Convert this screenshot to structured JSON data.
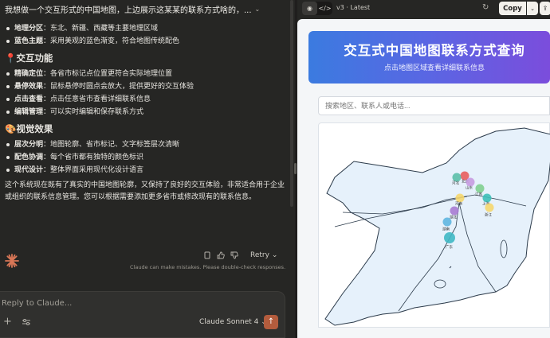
{
  "chat": {
    "title": "我想做一个交互形式的中国地图，上边展示这某某的联系方式啥的，...",
    "design_items": [
      {
        "label": "地理分区",
        "text": "：东北、新疆、西藏等主要地理区域"
      },
      {
        "label": "蓝色主题",
        "text": "：采用美观的蓝色渐变，符合地图传统配色"
      }
    ],
    "section_interaction": {
      "emoji": "📍",
      "title": "交互功能"
    },
    "interaction_items": [
      {
        "label": "精确定位",
        "text": "：各省市标记点位置更符合实际地理位置"
      },
      {
        "label": "悬停效果",
        "text": "：鼠标悬停时圆点会放大，提供更好的交互体验"
      },
      {
        "label": "点击查看",
        "text": "：点击任意省市查看详细联系信息"
      },
      {
        "label": "编辑管理",
        "text": "：可以实时编辑和保存联系方式"
      }
    ],
    "section_visual": {
      "emoji": "🎨",
      "title": "视觉效果"
    },
    "visual_items": [
      {
        "label": "层次分明",
        "text": "：地图轮廓、省市标记、文字标签层次清晰"
      },
      {
        "label": "配色协调",
        "text": "：每个省市都有独特的颜色标识"
      },
      {
        "label": "现代设计",
        "text": "：整体界面采用现代化设计语言"
      }
    ],
    "closing": "这个系统现在既有了真实的中国地图轮廓，又保持了良好的交互体验，非常适合用于企业或组织的联系信息管理。您可以根据需要添加更多省市或修改现有的联系信息。",
    "retry_label": "Retry",
    "disclaimer": "Claude can make mistakes. Please double-check responses.",
    "composer_placeholder": "Reply to Claude...",
    "model_label": "Claude Sonnet 4"
  },
  "artifact": {
    "version": "v3 · Latest",
    "copy_label": "Copy",
    "title": "交互式中国地图联系方式查询",
    "subtitle": "点击地图区域查看详细联系信息",
    "search_placeholder": "搜索地区、联系人或电话...",
    "markers": [
      {
        "label": "北京",
        "color": "#e85d5d"
      },
      {
        "label": "河北",
        "color": "#5bbfa8"
      },
      {
        "label": "山东",
        "color": "#c69be0"
      },
      {
        "label": "江苏",
        "color": "#7fcf8f"
      },
      {
        "label": "河南",
        "color": "#f5d76e"
      },
      {
        "label": "上海",
        "color": "#3dbfb8"
      },
      {
        "label": "浙江",
        "color": "#f5d76e"
      },
      {
        "label": "湖北",
        "color": "#a77bd1"
      },
      {
        "label": "湖南",
        "color": "#5fb6e0"
      },
      {
        "label": "广东",
        "color": "#3fb8c4"
      }
    ]
  }
}
